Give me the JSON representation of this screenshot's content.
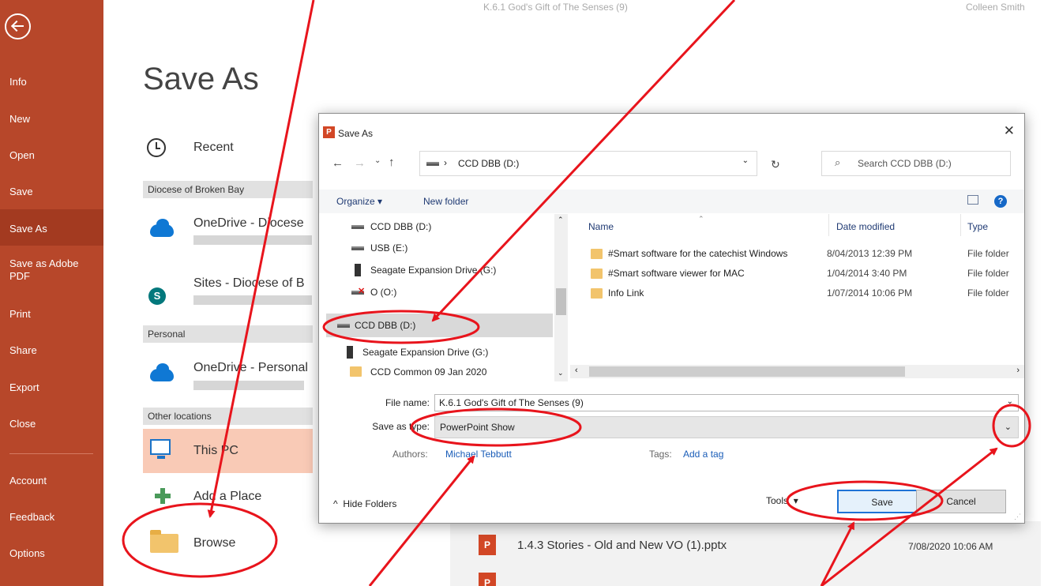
{
  "window": {
    "doc_title": "K.6.1 God's Gift of The Senses (9)",
    "user_name": "Colleen Smith"
  },
  "sidebar": {
    "back_icon": "back-arrow-icon",
    "items": [
      {
        "label": "Info"
      },
      {
        "label": "New"
      },
      {
        "label": "Open"
      },
      {
        "label": "Save"
      },
      {
        "label": "Save As"
      },
      {
        "label": "Save as Adobe PDF"
      },
      {
        "label": "Print"
      },
      {
        "label": "Share"
      },
      {
        "label": "Export"
      },
      {
        "label": "Close"
      },
      {
        "label": "Account"
      },
      {
        "label": "Feedback"
      },
      {
        "label": "Options"
      }
    ],
    "active_index": 4,
    "accent_color": "#b7472a"
  },
  "backstage": {
    "title": "Save As",
    "recent_label": "Recent",
    "group_broken_bay": "Diocese of Broken Bay",
    "onedrive_diocese": "OneDrive - Diocese",
    "sites_diocese": "Sites - Diocese of B",
    "group_personal": "Personal",
    "onedrive_personal": "OneDrive - Personal",
    "group_other": "Other locations",
    "this_pc": "This PC",
    "add_place": "Add a Place",
    "browse": "Browse",
    "recent_files": [
      {
        "name": "1.4.3 Stories - Old and New VO (1).pptx",
        "date": "7/08/2020 10:06 AM"
      }
    ]
  },
  "dialog": {
    "title": "Save As",
    "address": "CCD DBB (D:)",
    "search_placeholder": "Search CCD DBB (D:)",
    "organize_label": "Organize ▾",
    "new_folder_label": "New folder",
    "nav_items": [
      {
        "label": "CCD DBB (D:)",
        "icon": "drive-icon"
      },
      {
        "label": "USB (E:)",
        "icon": "drive-icon"
      },
      {
        "label": "Seagate Expansion Drive (G:)",
        "icon": "external-drive-icon"
      },
      {
        "label": "O (O:)",
        "icon": "network-drive-disconnected-icon"
      },
      {
        "label": "CCD DBB (D:)",
        "icon": "drive-icon",
        "selected": true
      },
      {
        "label": "Seagate Expansion Drive (G:)",
        "icon": "external-drive-icon"
      },
      {
        "label": "CCD Common 09 Jan 2020",
        "icon": "folder-icon"
      }
    ],
    "columns": {
      "name": "Name",
      "date": "Date modified",
      "type": "Type"
    },
    "files": [
      {
        "name": "#Smart software for the catechist Windows",
        "date": "8/04/2013 12:39 PM",
        "type": "File folder"
      },
      {
        "name": "#Smart software viewer for MAC",
        "date": "1/04/2014 3:40 PM",
        "type": "File folder"
      },
      {
        "name": "Info Link",
        "date": "1/07/2014 10:06 PM",
        "type": "File folder"
      }
    ],
    "file_name_label": "File name:",
    "file_name_value": "K.6.1 God's Gift of The Senses (9)",
    "save_type_label": "Save as type:",
    "save_type_value": "PowerPoint Show",
    "authors_label": "Authors:",
    "authors_value": "Michael Tebbutt",
    "tags_label": "Tags:",
    "tags_value": "Add a tag",
    "hide_folders": "Hide Folders",
    "tools_label": "Tools",
    "save_button": "Save",
    "cancel_button": "Cancel",
    "annotation_color": "#e8141c"
  }
}
